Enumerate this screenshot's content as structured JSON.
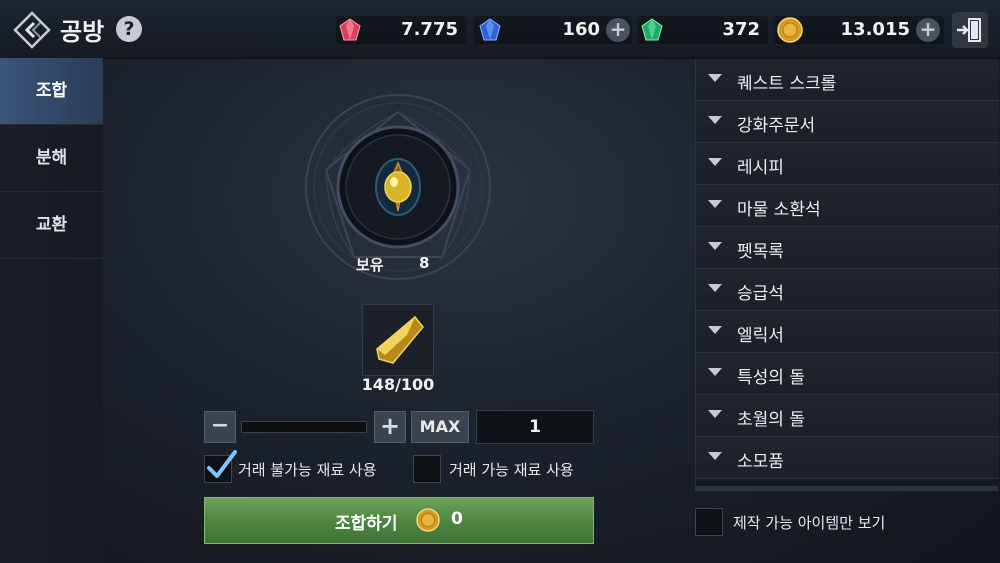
{
  "header": {
    "title": "공방",
    "help_label": "?",
    "currencies": [
      {
        "icon": "red-gem-icon",
        "value": "7.775"
      },
      {
        "icon": "blue-gem-icon",
        "value": "160"
      },
      {
        "icon": "green-gem-icon",
        "value": "372"
      },
      {
        "icon": "gold-coin-icon",
        "value": "13.015"
      }
    ],
    "plus_label": "+"
  },
  "tabs": [
    {
      "label": "조합",
      "active": true
    },
    {
      "label": "분해",
      "active": false
    },
    {
      "label": "교환",
      "active": false
    }
  ],
  "craft": {
    "owned_label": "보유",
    "owned_value": "8",
    "material_count": "148/100",
    "minus_label": "−",
    "plus_label": "+",
    "max_label": "MAX",
    "quantity": "1",
    "option_untradable": {
      "label": "거래 불가능 재료 사용",
      "checked": true
    },
    "option_tradable": {
      "label": "거래 가능 재료 사용",
      "checked": false
    },
    "craft_button_label": "조합하기",
    "craft_cost": "0"
  },
  "categories": [
    "퀘스트 스크롤",
    "강화주문서",
    "레시피",
    "마물 소환석",
    "펫목록",
    "승급석",
    "엘릭서",
    "특성의 돌",
    "초월의 돌",
    "소모품"
  ],
  "filter": {
    "label": "제작 가능 아이템만 보기",
    "checked": false
  },
  "colors": {
    "accent_tab": "#3a5578",
    "craft_button": "#4d8440",
    "gold": "#e0a92a"
  }
}
